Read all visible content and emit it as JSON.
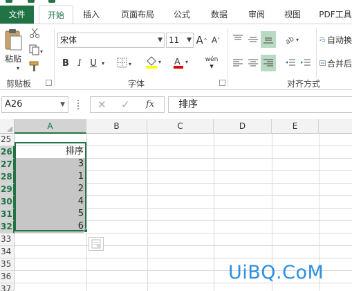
{
  "tabs": [
    {
      "label": "文件"
    },
    {
      "label": "开始"
    },
    {
      "label": "插入"
    },
    {
      "label": "页面布局"
    },
    {
      "label": "公式"
    },
    {
      "label": "数据"
    },
    {
      "label": "审阅"
    },
    {
      "label": "视图"
    },
    {
      "label": "PDF工具"
    }
  ],
  "ribbon": {
    "clipboard": {
      "paste_label": "粘贴",
      "group_label": "剪贴板"
    },
    "font": {
      "font_name": "宋体",
      "font_size": "11",
      "group_label": "字体",
      "bold": "B",
      "italic": "I",
      "underline": "U",
      "phonetic": "wén"
    },
    "alignment": {
      "group_label": "对齐方式",
      "wrap_label": "自动换",
      "merge_label": "合并后"
    }
  },
  "formula_bar": {
    "name_box": "A26",
    "fx": "fx",
    "content": "排序"
  },
  "columns": [
    "A",
    "B",
    "C",
    "D",
    "E"
  ],
  "rows": [
    {
      "num": "25",
      "a": ""
    },
    {
      "num": "26",
      "a": "排序"
    },
    {
      "num": "27",
      "a": "3"
    },
    {
      "num": "28",
      "a": "1"
    },
    {
      "num": "29",
      "a": "2"
    },
    {
      "num": "30",
      "a": "4"
    },
    {
      "num": "31",
      "a": "5"
    },
    {
      "num": "32",
      "a": "6"
    },
    {
      "num": "33",
      "a": ""
    },
    {
      "num": "34",
      "a": ""
    },
    {
      "num": "35",
      "a": ""
    },
    {
      "num": "36",
      "a": ""
    },
    {
      "num": "37",
      "a": ""
    }
  ],
  "watermark": "UiBQ.CoM",
  "colors": {
    "accent": "#217346",
    "selection_fill": "#c6c6c6",
    "watermark": "#2d8fe0"
  }
}
